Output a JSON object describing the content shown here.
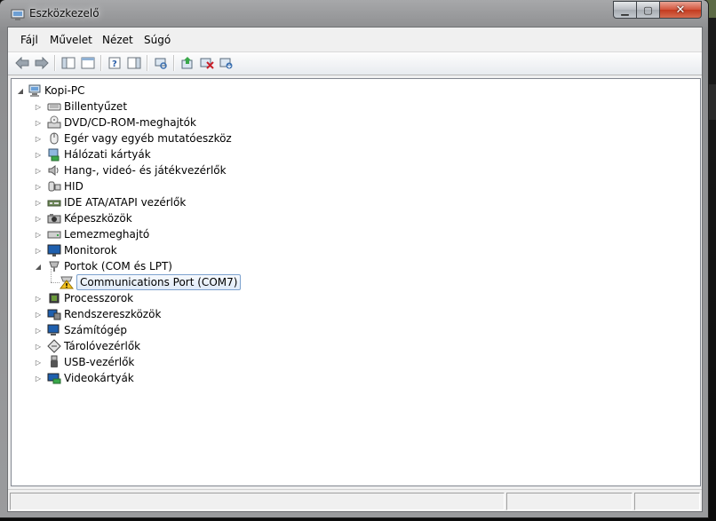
{
  "window": {
    "title": "Eszközkezelő"
  },
  "menu": [
    "Fájl",
    "Művelet",
    "Nézet",
    "Súgó"
  ],
  "toolbar": [
    "back-icon",
    "forward-icon",
    "show-hide-console-tree-icon",
    "properties-icon",
    "help-icon",
    "action-pane-icon",
    "scan-hardware-icon",
    "update-driver-icon",
    "disable-device-icon",
    "uninstall-device-icon"
  ],
  "tree": {
    "root": "Kopi-PC",
    "categories": [
      {
        "label": "Billentyűzet",
        "icon": "keyboard-icon"
      },
      {
        "label": "DVD/CD-ROM-meghajtók",
        "icon": "dvd-drive-icon"
      },
      {
        "label": "Egér vagy egyéb mutatóeszköz",
        "icon": "mouse-icon"
      },
      {
        "label": "Hálózati kártyák",
        "icon": "network-adapter-icon"
      },
      {
        "label": "Hang-, videó- és játékvezérlők",
        "icon": "speaker-icon"
      },
      {
        "label": "HID",
        "icon": "hid-icon"
      },
      {
        "label": "IDE ATA/ATAPI vezérlők",
        "icon": "ide-controller-icon"
      },
      {
        "label": "Képeszközök",
        "icon": "imaging-device-icon"
      },
      {
        "label": "Lemezmeghajtó",
        "icon": "disk-drive-icon"
      },
      {
        "label": "Monitorok",
        "icon": "monitor-icon"
      },
      {
        "label": "Portok (COM és LPT)",
        "icon": "port-icon",
        "expanded": true,
        "children": [
          {
            "label": "Communications Port (COM7)",
            "icon": "warning-port-icon",
            "selected": true
          }
        ]
      },
      {
        "label": "Processzorok",
        "icon": "processor-icon"
      },
      {
        "label": "Rendszereszközök",
        "icon": "system-device-icon"
      },
      {
        "label": "Számítógép",
        "icon": "computer-icon"
      },
      {
        "label": "Tárolóvezérlők",
        "icon": "storage-controller-icon"
      },
      {
        "label": "USB-vezérlők",
        "icon": "usb-icon"
      },
      {
        "label": "Videokártyák",
        "icon": "display-adapter-icon"
      }
    ]
  }
}
